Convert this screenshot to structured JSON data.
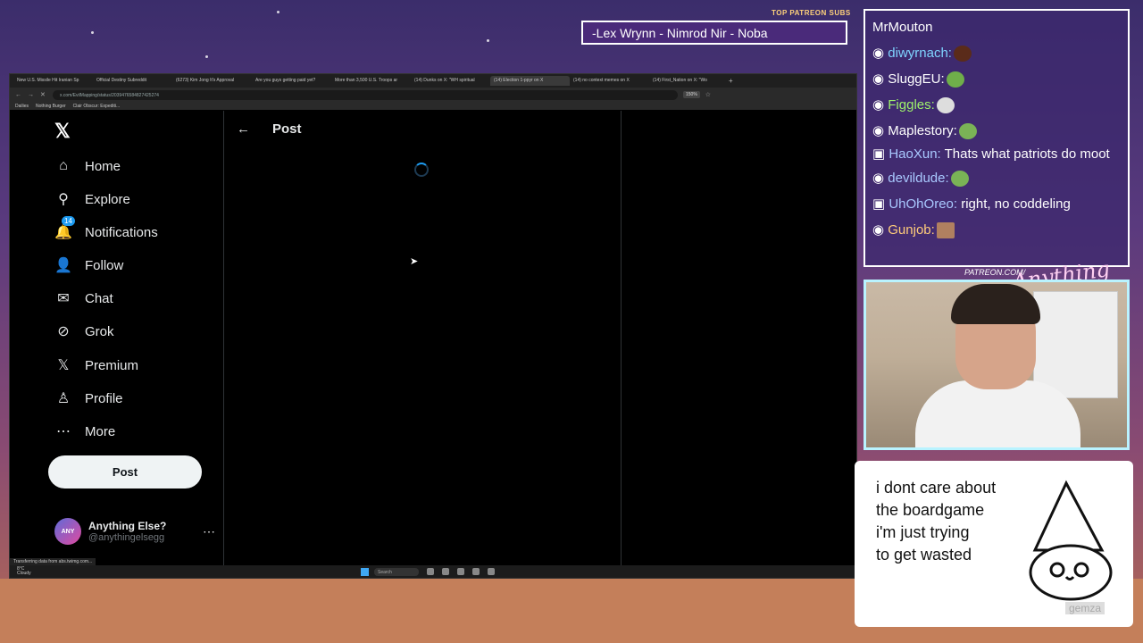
{
  "stream": {
    "patreon_label": "TOP PATREON SUBS",
    "patreon_names": "-Lex Wrynn - Nimrod Nir - Noba",
    "patreon_url": "PATREON.COM/",
    "logo_text": "Anything Else?"
  },
  "browser": {
    "tabs": [
      "New U.S. Missile Hit Iranian Sp",
      "Official Destiny Subreddit",
      "(6273) Kim Jong It's Approval",
      "Are you guys getting paid yet?",
      "More than 3,500 U.S. Troops ar",
      "(14) Dunks on X: \"WH spiritual",
      "(14) Election 1-ppyr on X",
      "(14) no context memes on X",
      "(14) First_Nation on X: \"Wo"
    ],
    "active_tab_index": 6,
    "new_tab_glyph": "+",
    "url": "x.com/EvilMapping/status/2039476584827425274",
    "zoom": "150%",
    "bookmarks": [
      "Dailies",
      "Nothing Burger",
      "Clair Obscur: Expediti..."
    ],
    "status_text": "Transferring data from abs.twimg.com..."
  },
  "x": {
    "logo": "𝕏",
    "nav": [
      {
        "label": "Home",
        "icon": "home-icon",
        "glyph": "⌂"
      },
      {
        "label": "Explore",
        "icon": "search-icon",
        "glyph": "⚲"
      },
      {
        "label": "Notifications",
        "icon": "bell-icon",
        "glyph": "🔔",
        "badge": "14"
      },
      {
        "label": "Follow",
        "icon": "follow-icon",
        "glyph": "👤"
      },
      {
        "label": "Chat",
        "icon": "mail-icon",
        "glyph": "✉"
      },
      {
        "label": "Grok",
        "icon": "grok-icon",
        "glyph": "⊘"
      },
      {
        "label": "Premium",
        "icon": "x-premium-icon",
        "glyph": "𝕏"
      },
      {
        "label": "Profile",
        "icon": "profile-icon",
        "glyph": "♙"
      },
      {
        "label": "More",
        "icon": "more-circle-icon",
        "glyph": "⋯"
      }
    ],
    "post_button": "Post",
    "account": {
      "name": "Anything Else?",
      "handle": "@anythingelsegg",
      "avatar_text": "ANY"
    },
    "main_title": "Post",
    "back_glyph": "←",
    "more_glyph": "⋯"
  },
  "taskbar": {
    "weather_temp": "8°C",
    "weather_desc": "Cloudy",
    "search_placeholder": "Search"
  },
  "chat": [
    {
      "user": "MrMouton",
      "text": "",
      "color": "#ffffff"
    },
    {
      "user": "diwyrnach:",
      "text": "",
      "color": "#7fd4ff",
      "emote": "#5a2b1a"
    },
    {
      "user": "SluggEU:",
      "text": "",
      "color": "#ffffff",
      "emote": "#6fae4a"
    },
    {
      "user": "Figgles:",
      "text": "",
      "color": "#9ef26b",
      "emote": "#dddddd"
    },
    {
      "user": "Maplestory:",
      "text": "",
      "color": "#ffffff",
      "emote": "#7ab356"
    },
    {
      "user": "HaoXun:",
      "text": "Thats what patriots do moot",
      "color": "#a9c9ff"
    },
    {
      "user": "devildude:",
      "text": "",
      "color": "#a9c9ff",
      "emote": "#7ab356"
    },
    {
      "user": "UhOhOreo:",
      "text": "right, no coddeling",
      "color": "#a9c9ff"
    },
    {
      "user": "Gunjob:",
      "text": "",
      "color": "#ffcc7a",
      "emote": "#b08060"
    }
  ],
  "meme": {
    "lines": [
      "i dont care about",
      "the boardgame",
      "i'm just trying",
      "to get wasted"
    ],
    "tag": "gemza"
  }
}
